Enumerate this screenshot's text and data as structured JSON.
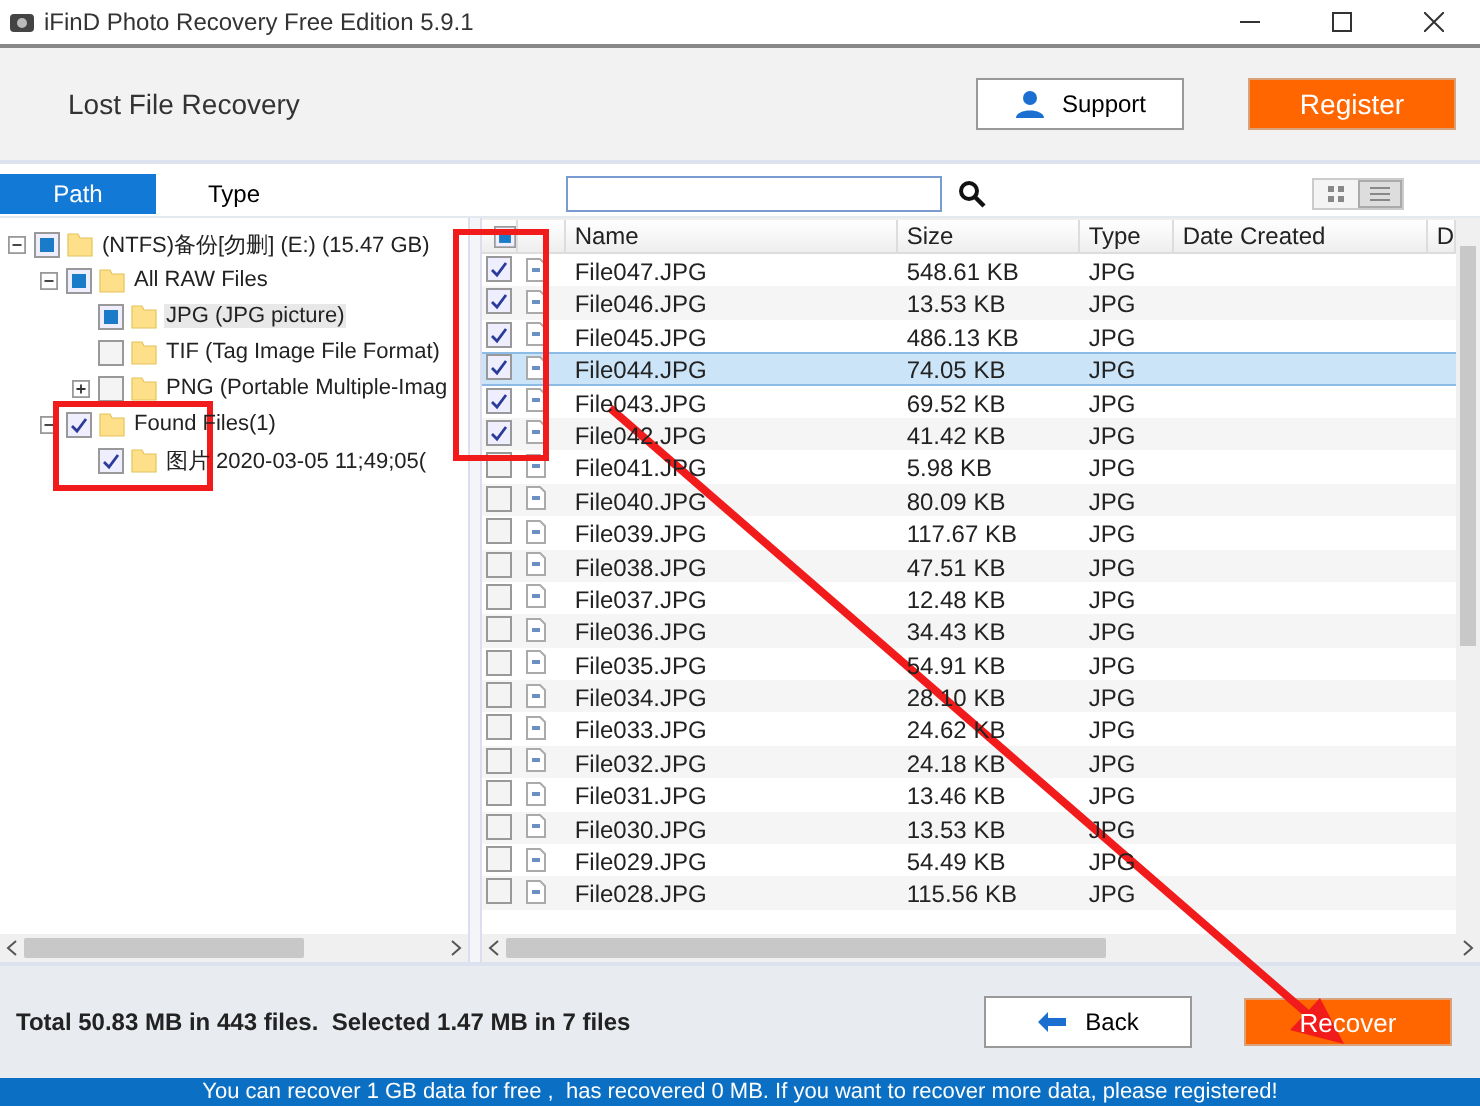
{
  "window": {
    "title": "iFinD Photo Recovery Free Edition 5.9.1"
  },
  "header": {
    "title": "Lost File Recovery",
    "support": "Support",
    "register": "Register"
  },
  "tabs": [
    {
      "label": "Path",
      "selected": true
    },
    {
      "label": "Type",
      "selected": false
    }
  ],
  "view_modes": [
    {
      "kind": "grid",
      "selected": false
    },
    {
      "kind": "list",
      "selected": true
    }
  ],
  "tree": [
    {
      "label": "(NTFS)备份[勿删] (E:) (15.47 GB)",
      "checked": false,
      "partial": true,
      "expanded": true,
      "selected": false,
      "children": [
        {
          "label": "All RAW Files",
          "checked": false,
          "partial": true,
          "expanded": true,
          "selected": false,
          "children": [
            {
              "label": "JPG (JPG picture)",
              "checked": false,
              "partial": true,
              "selected": true
            },
            {
              "label": "TIF (Tag Image File Format)",
              "checked": false,
              "partial": false,
              "selected": false
            },
            {
              "label": "PNG (Portable Multiple-Imag",
              "checked": false,
              "partial": false,
              "expanded": false,
              "selected": false
            }
          ]
        },
        {
          "label": "Found Files(1)",
          "checked": true,
          "partial": false,
          "expanded": true,
          "selected": false,
          "children": [
            {
              "label": "图片 2020-03-05 11;49;05(",
              "checked": true,
              "partial": false,
              "selected": false
            }
          ]
        }
      ]
    }
  ],
  "table": {
    "header_check": {
      "checked": false,
      "partial": true
    },
    "columns": [
      "Name",
      "Size",
      "Type",
      "Date Created",
      "D"
    ],
    "rows": [
      {
        "name": "File047.JPG",
        "size": "548.61 KB",
        "type": "JPG",
        "checked": true,
        "selected": false
      },
      {
        "name": "File046.JPG",
        "size": "13.53 KB",
        "type": "JPG",
        "checked": true,
        "selected": false
      },
      {
        "name": "File045.JPG",
        "size": "486.13 KB",
        "type": "JPG",
        "checked": true,
        "selected": false
      },
      {
        "name": "File044.JPG",
        "size": "74.05 KB",
        "type": "JPG",
        "checked": true,
        "selected": true
      },
      {
        "name": "File043.JPG",
        "size": "69.52 KB",
        "type": "JPG",
        "checked": true,
        "selected": false
      },
      {
        "name": "File042.JPG",
        "size": "41.42 KB",
        "type": "JPG",
        "checked": true,
        "selected": false
      },
      {
        "name": "File041.JPG",
        "size": "5.98 KB",
        "type": "JPG",
        "checked": false,
        "selected": false
      },
      {
        "name": "File040.JPG",
        "size": "80.09 KB",
        "type": "JPG",
        "checked": false,
        "selected": false
      },
      {
        "name": "File039.JPG",
        "size": "117.67 KB",
        "type": "JPG",
        "checked": false,
        "selected": false
      },
      {
        "name": "File038.JPG",
        "size": "47.51 KB",
        "type": "JPG",
        "checked": false,
        "selected": false
      },
      {
        "name": "File037.JPG",
        "size": "12.48 KB",
        "type": "JPG",
        "checked": false,
        "selected": false
      },
      {
        "name": "File036.JPG",
        "size": "34.43 KB",
        "type": "JPG",
        "checked": false,
        "selected": false
      },
      {
        "name": "File035.JPG",
        "size": "54.91 KB",
        "type": "JPG",
        "checked": false,
        "selected": false
      },
      {
        "name": "File034.JPG",
        "size": "28.10 KB",
        "type": "JPG",
        "checked": false,
        "selected": false
      },
      {
        "name": "File033.JPG",
        "size": "24.62 KB",
        "type": "JPG",
        "checked": false,
        "selected": false
      },
      {
        "name": "File032.JPG",
        "size": "24.18 KB",
        "type": "JPG",
        "checked": false,
        "selected": false
      },
      {
        "name": "File031.JPG",
        "size": "13.46 KB",
        "type": "JPG",
        "checked": false,
        "selected": false
      },
      {
        "name": "File030.JPG",
        "size": "13.53 KB",
        "type": "JPG",
        "checked": false,
        "selected": false
      },
      {
        "name": "File029.JPG",
        "size": "54.49 KB",
        "type": "JPG",
        "checked": false,
        "selected": false
      },
      {
        "name": "File028.JPG",
        "size": "115.56 KB",
        "type": "JPG",
        "checked": false,
        "selected": false
      }
    ]
  },
  "status": "Total 50.83 MB in 443 files.  Selected 1.47 MB in 7 files",
  "buttons": {
    "back": "Back",
    "recover": "Recover"
  },
  "banner": "You can recover 1 GB data for free ,  has recovered 0 MB. If you want to recover more data, please registered!"
}
